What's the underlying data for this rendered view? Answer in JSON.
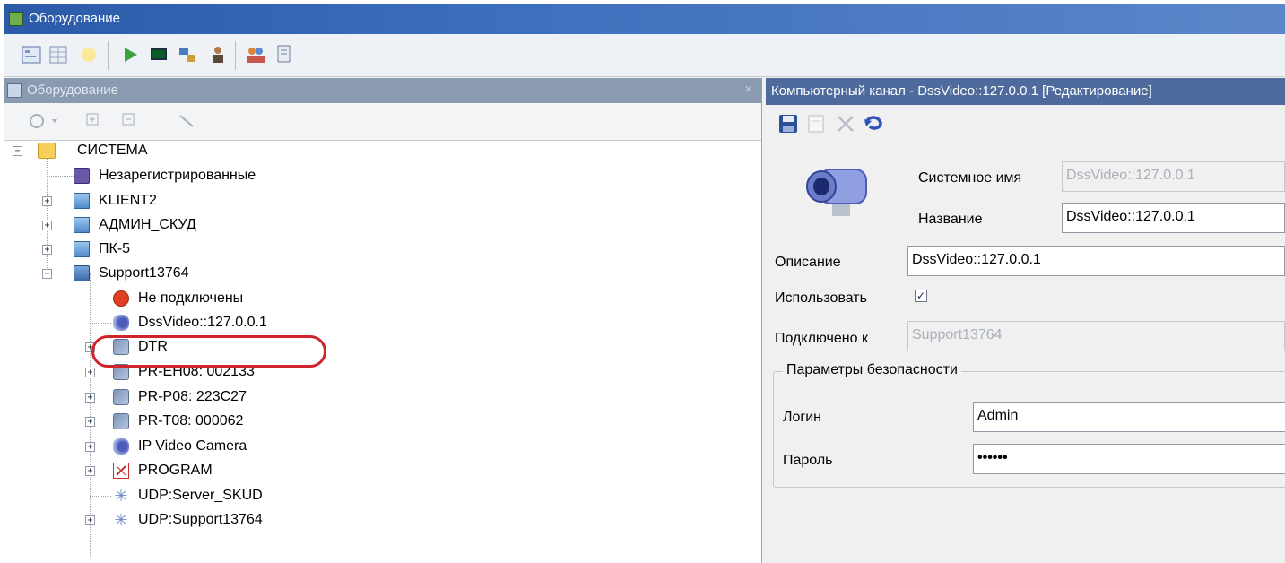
{
  "window": {
    "title": "Оборудование"
  },
  "main_toolbar": {
    "buttons": [
      "properties-icon",
      "grid-icon",
      "sun-icon",
      "play-icon",
      "monitor-icon",
      "network-icon",
      "user-icon",
      "users-icon",
      "document-icon"
    ]
  },
  "left_pane": {
    "title": "Оборудование",
    "close_glyph": "×",
    "toolbar": [
      "add-icon",
      "expand-all-icon",
      "collapse-all-icon",
      "pencil-icon"
    ]
  },
  "tree": {
    "root": {
      "label": "СИСТЕМА",
      "expander": "−"
    },
    "items": [
      {
        "label": "Незарегистрированные",
        "icon": "unregistered-icon"
      },
      {
        "label": "KLIENT2",
        "icon": "computer-icon",
        "expander": "+"
      },
      {
        "label": "АДМИН_СКУД",
        "icon": "computer-icon",
        "expander": "+"
      },
      {
        "label": "ПК-5",
        "icon": "computer-icon",
        "expander": "+"
      },
      {
        "label": "Support13764",
        "icon": "server-icon",
        "expander": "−"
      }
    ],
    "children": [
      {
        "label": "Не подключены",
        "icon": "not-connected-icon"
      },
      {
        "label": "DssVideo::127.0.0.1",
        "icon": "camera-icon",
        "selected": true
      },
      {
        "label": "DTR",
        "icon": "device-icon",
        "expander": "+"
      },
      {
        "label": "PR-EH08: 002133",
        "icon": "device-icon",
        "expander": "+"
      },
      {
        "label": "PR-P08: 223C27",
        "icon": "device-icon",
        "expander": "+"
      },
      {
        "label": "PR-T08: 000062",
        "icon": "device-icon",
        "expander": "+"
      },
      {
        "label": "IP Video Camera",
        "icon": "camera-icon",
        "expander": "+"
      },
      {
        "label": "PROGRAM",
        "icon": "program-icon",
        "expander": "+"
      },
      {
        "label": "UDP:Server_SKUD",
        "icon": "udp-icon"
      },
      {
        "label": "UDP:Support13764",
        "icon": "udp-icon",
        "expander": "+"
      }
    ]
  },
  "right_pane": {
    "title": "Компьютерный канал - DssVideo::127.0.0.1 [Редактирование]",
    "toolbar": {
      "save": "save-icon",
      "edit": "edit-icon",
      "delete": "delete-icon",
      "undo": "undo-icon"
    },
    "system_name": {
      "label": "Системное имя",
      "value": "DssVideo::127.0.0.1"
    },
    "name": {
      "label": "Название",
      "value": "DssVideo::127.0.0.1"
    },
    "description": {
      "label": "Описание",
      "value": "DssVideo::127.0.0.1"
    },
    "use": {
      "label": "Использовать",
      "checked": true,
      "glyph": "✓"
    },
    "connected_to": {
      "label": "Подключено к",
      "value": "Support13764"
    },
    "security": {
      "title": "Параметры безопасности",
      "login": {
        "label": "Логин",
        "value": "Admin"
      },
      "password": {
        "label": "Пароль",
        "value": "••••••"
      }
    }
  }
}
